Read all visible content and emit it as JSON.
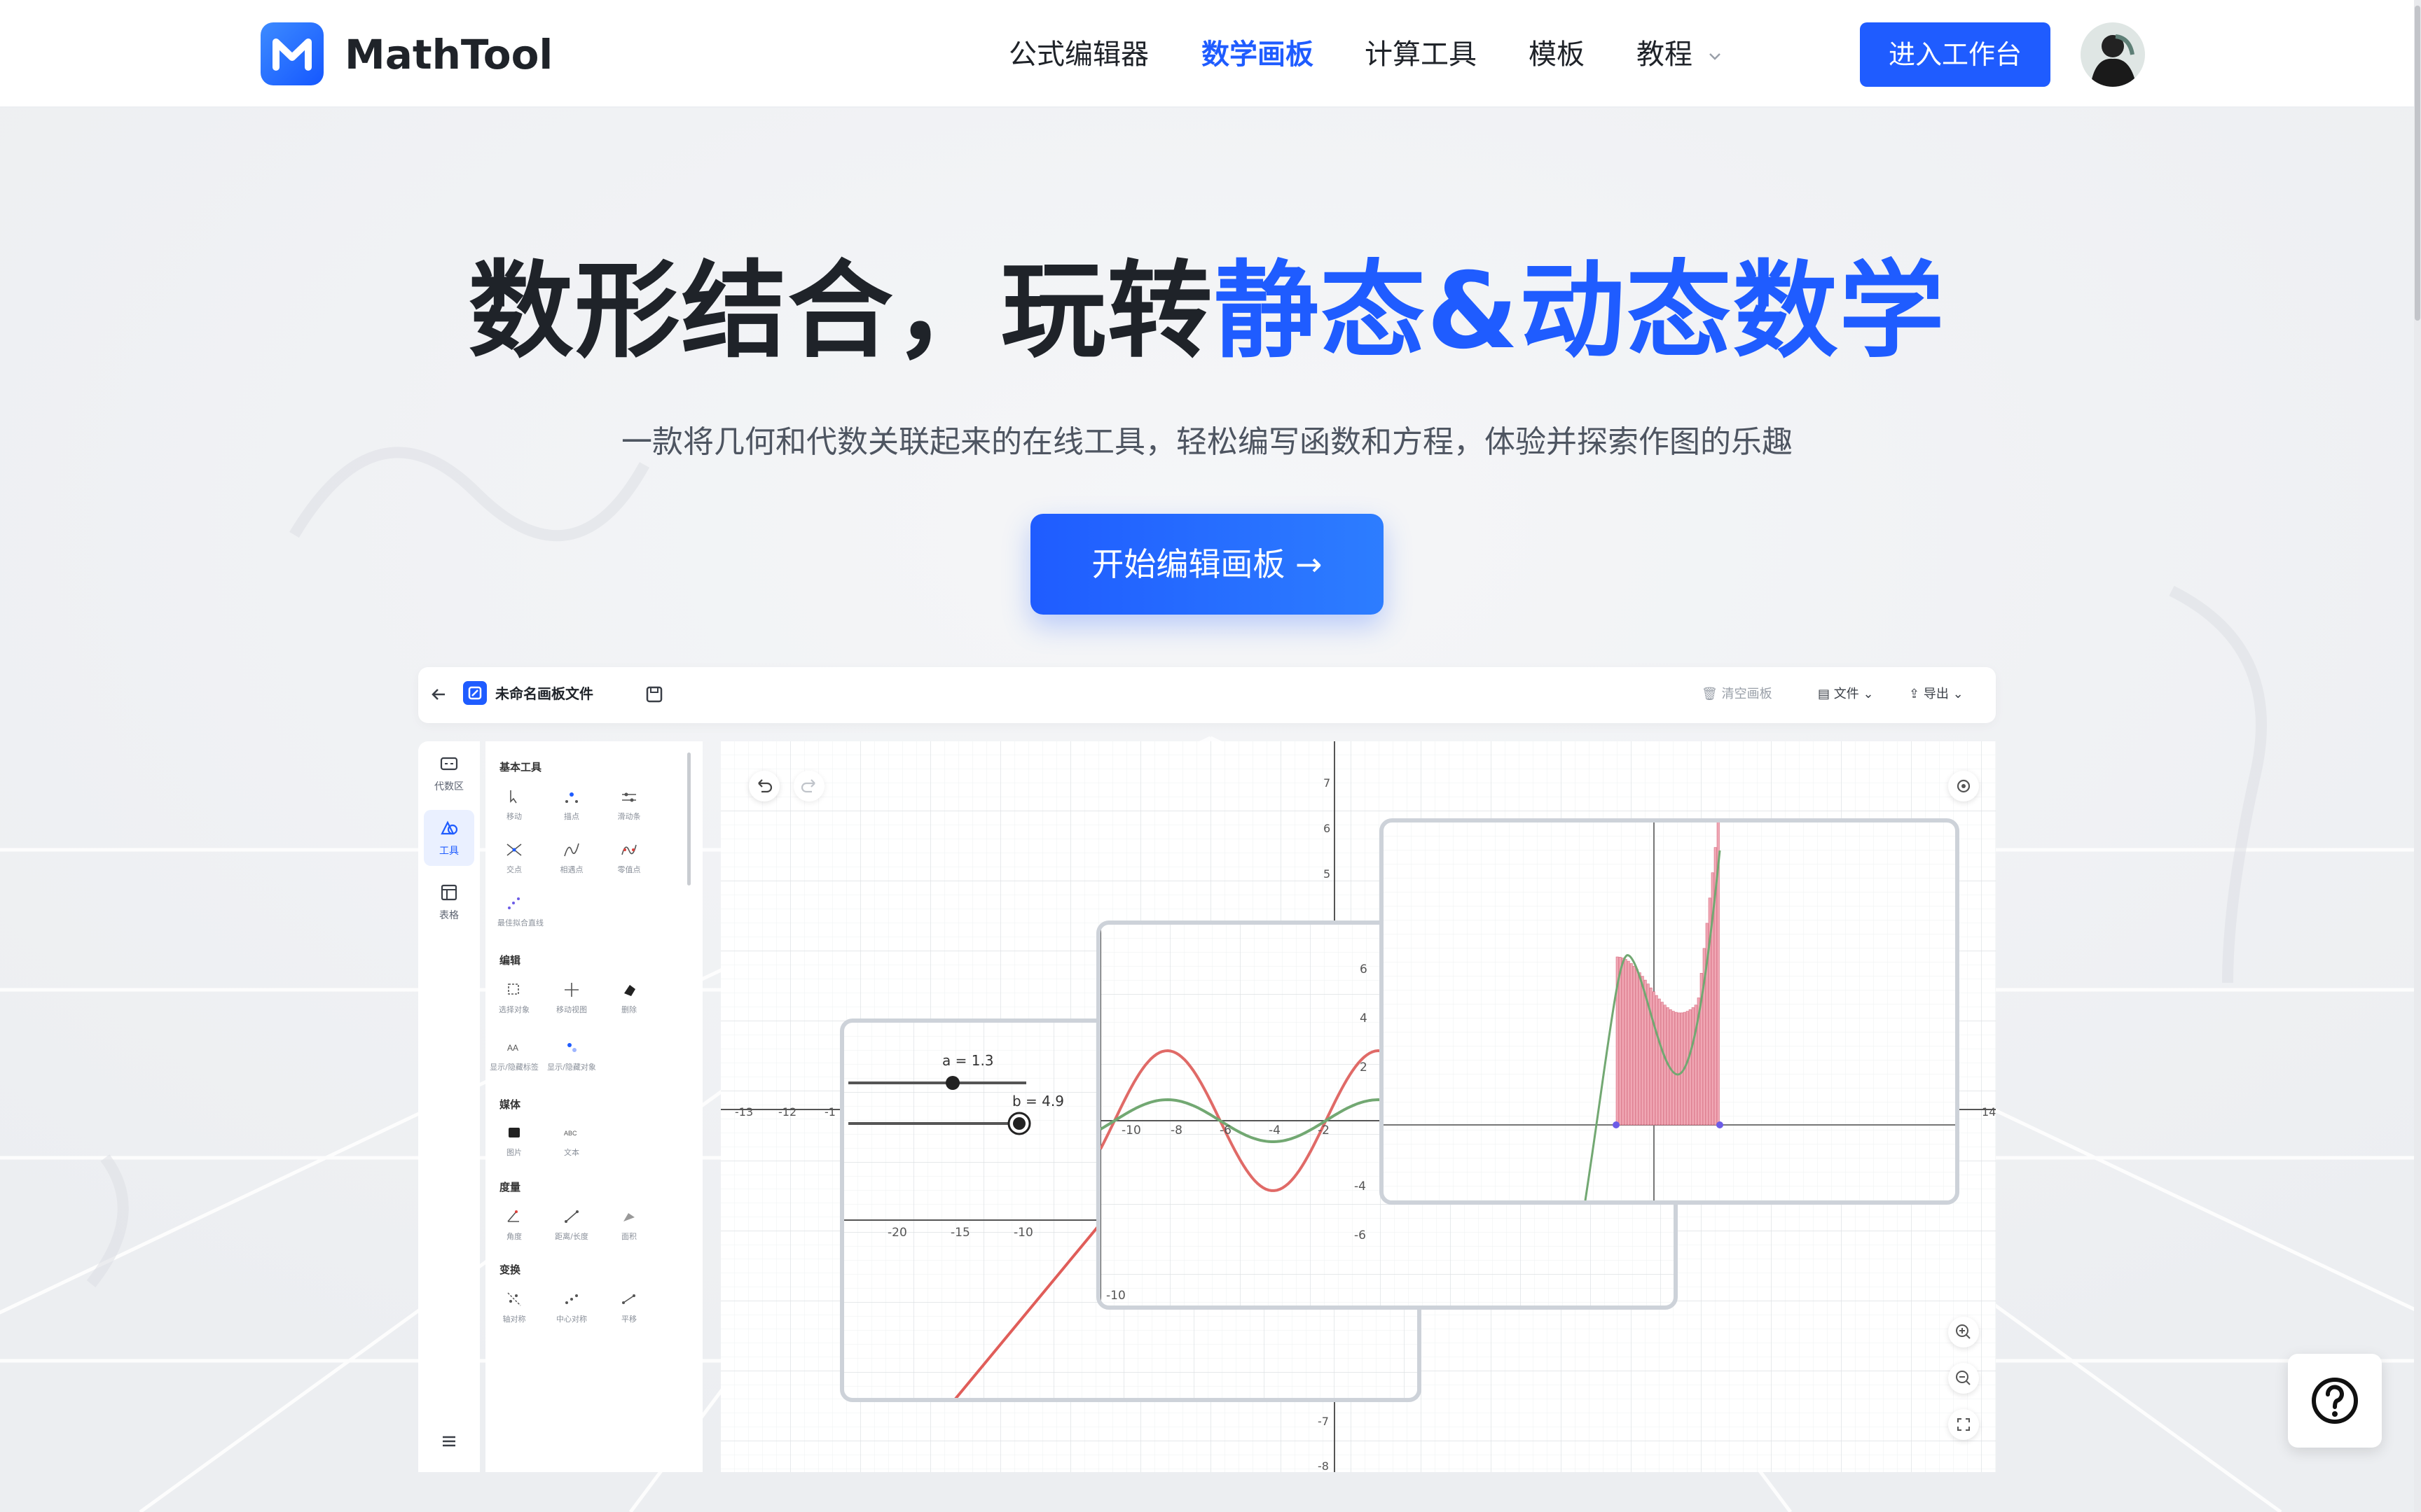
{
  "nav": {
    "brand": "MathTool",
    "items": [
      {
        "label": "公式编辑器",
        "active": false
      },
      {
        "label": "数学画板",
        "active": true
      },
      {
        "label": "计算工具",
        "active": false
      },
      {
        "label": "模板",
        "active": false
      },
      {
        "label": "教程",
        "active": false
      }
    ],
    "enter_label": "进入工作台"
  },
  "hero": {
    "title_dark": "数形结合，玩转",
    "title_blue": "静态&动态数学",
    "subtitle": "一款将几何和代数关联起来的在线工具，轻松编写函数和方程，体验并探索作图的乐趣",
    "cta_label": "开始编辑画板 →"
  },
  "app": {
    "file_name": "未命名画板文件",
    "toolbar": {
      "clear": "清空画板",
      "file": "文件",
      "export": "导出"
    },
    "rail": [
      {
        "label": "代数区",
        "icon": "algebra-icon"
      },
      {
        "label": "工具",
        "icon": "shapes-icon"
      },
      {
        "label": "表格",
        "icon": "table-icon"
      }
    ],
    "sections": {
      "basic": "基本工具",
      "edit": "编辑",
      "media": "媒体",
      "measure": "度量",
      "transform": "变换"
    },
    "tools": {
      "basic": [
        "移动",
        "描点",
        "滑动条",
        "交点",
        "相遇点",
        "零值点",
        "最佳拟合直线"
      ],
      "edit": [
        "选择对象",
        "移动视图",
        "删除",
        "显示/隐藏标签",
        "显示/隐藏对象"
      ],
      "media": [
        "图片",
        "文本"
      ],
      "measure": [
        "角度",
        "距离/长度",
        "面积"
      ],
      "transform": [
        "轴对称",
        "中心对称",
        "平移"
      ]
    },
    "sliders": {
      "a": "a = 1.3",
      "b": "b = 4.9"
    },
    "axis": {
      "bg_left": [
        "-13",
        "-12",
        "-1"
      ],
      "bg_right": "14",
      "bg_y": [
        "7",
        "6",
        "5",
        "-7",
        "-8"
      ],
      "card1_x": [
        "-20",
        "-15",
        "-10"
      ],
      "card2_x": [
        "-10",
        "-8",
        "-6",
        "-4",
        "-2"
      ],
      "card2_y": [
        "6",
        "4",
        "2",
        "-4",
        "-6",
        "-10"
      ]
    }
  }
}
